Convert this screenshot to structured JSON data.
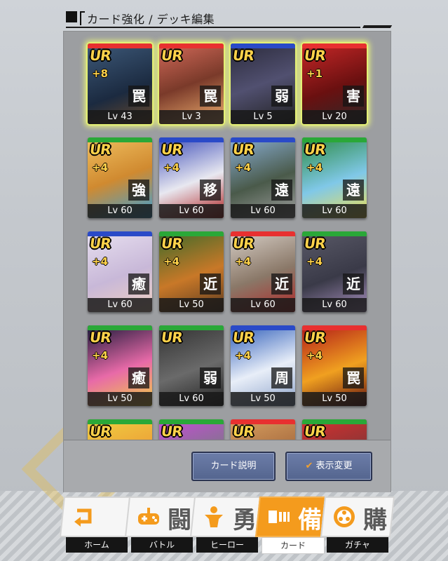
{
  "header": {
    "title": "カード強化 / デッキ編集"
  },
  "cards": [
    {
      "rarity": "UR",
      "plus": "+8",
      "type": "罠",
      "level": "Lv 43",
      "selected": true,
      "art": "linear-gradient(160deg,#3e5a7a,#1b2a40 60%,#6b4a2a)",
      "bar": "#e83030"
    },
    {
      "rarity": "UR",
      "plus": "",
      "type": "罠",
      "level": "Lv 3",
      "selected": true,
      "art": "linear-gradient(160deg,#d46a5a,#7a3a2a 50%,#f0b070)",
      "bar": "#e83030"
    },
    {
      "rarity": "UR",
      "plus": "",
      "type": "弱",
      "level": "Lv 5",
      "selected": true,
      "art": "linear-gradient(160deg,#2a2a3a,#515070 50%,#202020)",
      "bar": "#2a4ac8"
    },
    {
      "rarity": "UR",
      "plus": "+1",
      "type": "害",
      "level": "Lv 20",
      "selected": true,
      "art": "linear-gradient(160deg,#c82828,#6a1010 55%,#2a2a2a)",
      "bar": "#e83030"
    },
    {
      "rarity": "UR",
      "plus": "+4",
      "type": "強",
      "level": "Lv 60",
      "selected": false,
      "art": "linear-gradient(160deg,#f0c060,#d08a30 50%,#3aa0d8)",
      "bar": "#2aa838"
    },
    {
      "rarity": "UR",
      "plus": "+4",
      "type": "移",
      "level": "Lv 60",
      "selected": false,
      "art": "linear-gradient(160deg,#3a4ab8,#e8e8f0 55%,#b02020)",
      "bar": "#2a4ac8"
    },
    {
      "rarity": "UR",
      "plus": "+4",
      "type": "遠",
      "level": "Lv 60",
      "selected": false,
      "art": "linear-gradient(160deg,#8ab0d8,#4a5a4a 55%,#a0a0a0)",
      "bar": "#2a4ac8"
    },
    {
      "rarity": "UR",
      "plus": "+4",
      "type": "遠",
      "level": "Lv 60",
      "selected": false,
      "art": "linear-gradient(160deg,#2a8a40,#80c8e8 55%,#f0e050)",
      "bar": "#2aa838"
    },
    {
      "rarity": "UR",
      "plus": "+4",
      "type": "癒",
      "level": "Lv 60",
      "selected": false,
      "art": "linear-gradient(160deg,#e8e0f0,#c8b8d8 55%,#f0d0c0)",
      "bar": "#2a4ac8"
    },
    {
      "rarity": "UR",
      "plus": "+4",
      "type": "近",
      "level": "Lv 50",
      "selected": false,
      "art": "linear-gradient(160deg,#3a6a2a,#c87828 55%,#5a3a20)",
      "bar": "#2aa838"
    },
    {
      "rarity": "UR",
      "plus": "+4",
      "type": "近",
      "level": "Lv 60",
      "selected": false,
      "art": "linear-gradient(160deg,#d8d0c8,#8a7868 55%,#b02828)",
      "bar": "#e83030"
    },
    {
      "rarity": "UR",
      "plus": "+4",
      "type": "近",
      "level": "Lv 60",
      "selected": false,
      "art": "linear-gradient(160deg,#5a5a68,#3a3a48 55%,#a890c0)",
      "bar": "#2aa838"
    },
    {
      "rarity": "UR",
      "plus": "+4",
      "type": "癒",
      "level": "Lv 50",
      "selected": false,
      "art": "linear-gradient(160deg,#181838,#e86aa8 55%,#f0d040)",
      "bar": "#2aa838"
    },
    {
      "rarity": "UR",
      "plus": "",
      "type": "弱",
      "level": "Lv 60",
      "selected": false,
      "art": "linear-gradient(160deg,#303030,#6a6a6a 55%,#202020)",
      "bar": "#2aa838"
    },
    {
      "rarity": "UR",
      "plus": "+4",
      "type": "周",
      "level": "Lv 50",
      "selected": false,
      "art": "linear-gradient(160deg,#2a5ab8,#e8eef8 55%,#8aa0c8)",
      "bar": "#2a4ac8"
    },
    {
      "rarity": "UR",
      "plus": "+4",
      "type": "罠",
      "level": "Lv 50",
      "selected": false,
      "art": "linear-gradient(160deg,#b01818,#f0a020 55%,#601010)",
      "bar": "#e83030"
    },
    {
      "rarity": "UR",
      "plus": "",
      "type": "",
      "level": "",
      "selected": false,
      "art": "linear-gradient(160deg,#f0d040,#e87030)",
      "bar": "#2aa838"
    },
    {
      "rarity": "UR",
      "plus": "",
      "type": "",
      "level": "",
      "selected": false,
      "art": "linear-gradient(160deg,#c84ad8,#3aa040)",
      "bar": "#2aa838"
    },
    {
      "rarity": "UR",
      "plus": "",
      "type": "",
      "level": "",
      "selected": false,
      "art": "linear-gradient(160deg,#d8a060,#7a3a20)",
      "bar": "#e83030"
    },
    {
      "rarity": "UR",
      "plus": "",
      "type": "",
      "level": "",
      "selected": false,
      "art": "linear-gradient(160deg,#d83030,#3a3a3a)",
      "bar": "#2aa838"
    }
  ],
  "buttons": {
    "card_desc": "カード説明",
    "display_change": "表示変更"
  },
  "nav": [
    {
      "label": "ホーム",
      "kanji": "",
      "icon": "back-arrow-icon",
      "active": false
    },
    {
      "label": "バトル",
      "kanji": "闘",
      "icon": "gamepad-icon",
      "active": false
    },
    {
      "label": "ヒーロー",
      "kanji": "勇",
      "icon": "hero-icon",
      "active": false
    },
    {
      "label": "カード",
      "kanji": "備",
      "icon": "cards-icon",
      "active": true
    },
    {
      "label": "ガチャ",
      "kanji": "購",
      "icon": "gacha-icon",
      "active": false
    }
  ]
}
